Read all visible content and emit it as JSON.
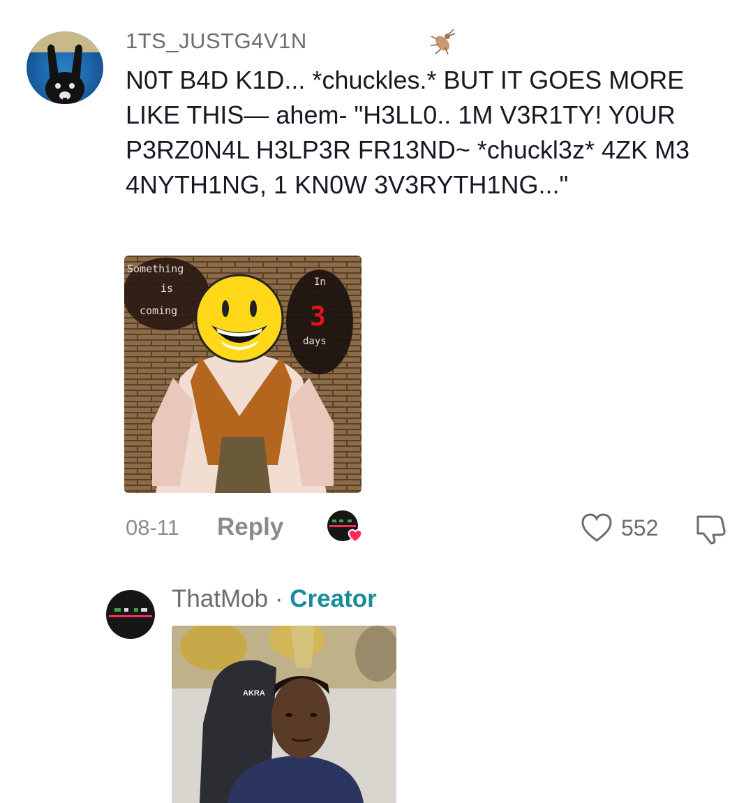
{
  "comment1": {
    "username": "1TS_JUSTG4V1N",
    "text": "N0T B4D K1D... *chuckles.* BUT IT GOES MORE LIKE THIS— ahem- \"H3LL0.. 1M V3R1TY! Y0UR P3RZ0N4L H3LP3R FR13ND~ *chuckl3z* 4ZK M3 4NYTH1NG, 1 KN0W 3V3RYTH1NG...\"",
    "image_text": {
      "line1": "Something",
      "line2": "is",
      "line3": "coming",
      "in": "In",
      "number": "3",
      "days": "days"
    },
    "date": "08-11",
    "reply_label": "Reply",
    "like_count": "552",
    "icons": {
      "badge": "bug-icon",
      "creator_liked": "creator-liked-icon",
      "like": "heart-icon",
      "dislike": "dislike-icon"
    }
  },
  "comment2": {
    "username": "ThatMob",
    "separator": "·",
    "badge": "Creator",
    "image_text": {
      "chair_brand": "AKRA"
    }
  },
  "colors": {
    "creator_accent": "#1a8b9a",
    "muted_text": "#8a8b91",
    "heart_red": "#fe2c55"
  }
}
